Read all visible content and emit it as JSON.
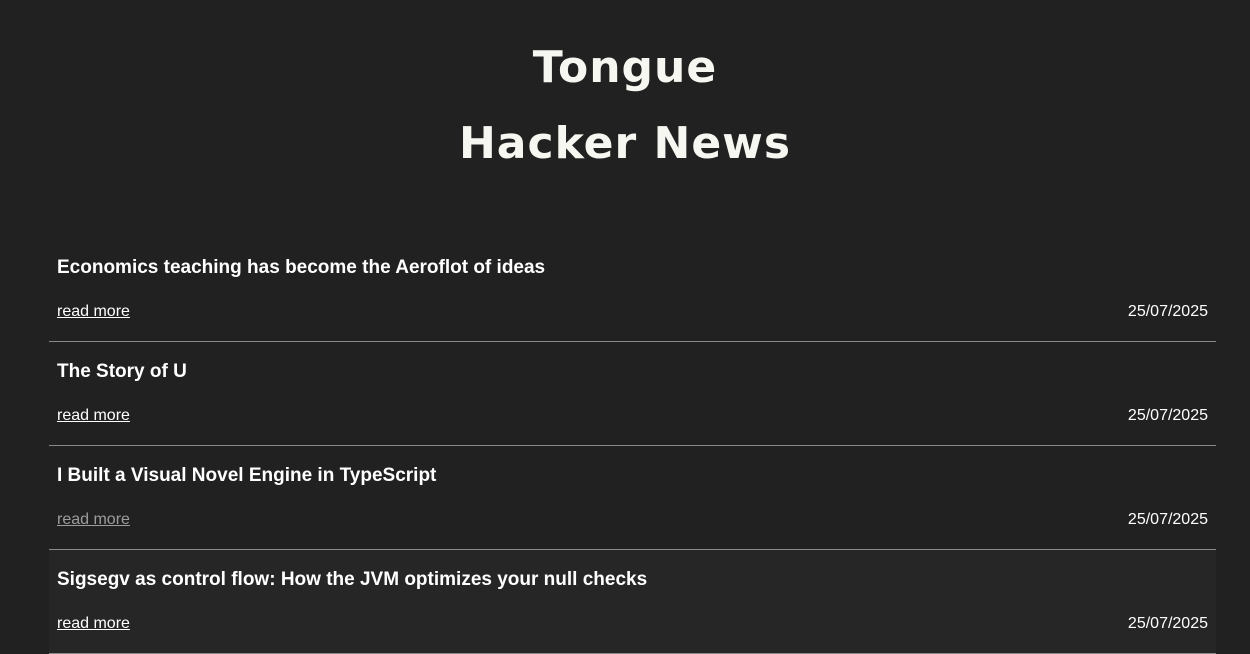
{
  "header": {
    "title_line1": "Tongue",
    "title_line2": "Hacker News"
  },
  "articles": [
    {
      "title": "Economics teaching has become the Aeroflot of ideas",
      "link_label": "read more",
      "date": "25/07/2025",
      "visited": false
    },
    {
      "title": "The Story of U",
      "link_label": "read more",
      "date": "25/07/2025",
      "visited": false
    },
    {
      "title": "I Built a Visual Novel Engine in TypeScript",
      "link_label": "read more",
      "date": "25/07/2025",
      "visited": true
    },
    {
      "title": "Sigsegv as control flow: How the JVM optimizes your null checks",
      "link_label": "read more",
      "date": "25/07/2025",
      "visited": false
    }
  ],
  "colors": {
    "background": "#212121",
    "text": "#ffffff",
    "visited_link": "#9d9d9d",
    "divider": "#8a8a8a"
  }
}
